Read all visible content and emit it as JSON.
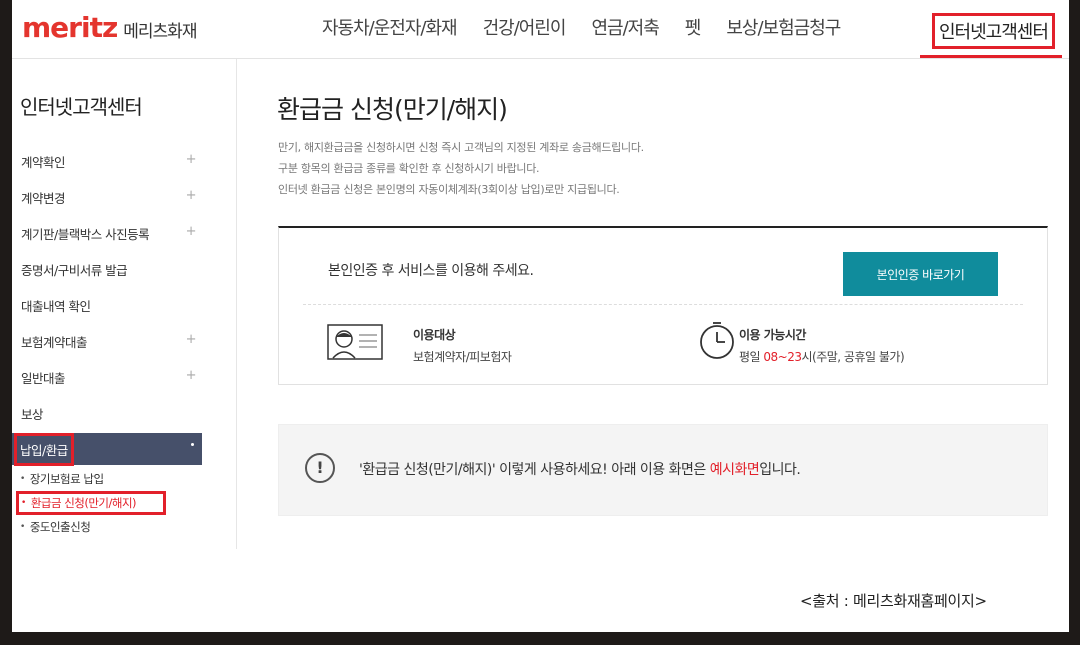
{
  "header": {
    "logo_brand": "meritz",
    "logo_sub": "메리츠화재",
    "nav": [
      "자동차/운전자/화재",
      "건강/어린이",
      "연금/저축",
      "펫",
      "보상/보험금청구"
    ],
    "nav_active": "인터넷고객센터"
  },
  "sidebar": {
    "title": "인터넷고객센터",
    "items": [
      {
        "label": "계약확인",
        "plus": "+"
      },
      {
        "label": "계약변경",
        "plus": "+"
      },
      {
        "label": "계기판/블랙박스 사진등록",
        "plus": "+"
      },
      {
        "label": "증명서/구비서류 발급",
        "plus": ""
      },
      {
        "label": "대출내역 확인",
        "plus": ""
      },
      {
        "label": "보험계약대출",
        "plus": "+"
      },
      {
        "label": "일반대출",
        "plus": "+"
      },
      {
        "label": "보상",
        "plus": ""
      }
    ],
    "active_item": "납입/환급",
    "sub_items": [
      "장기보험료 납입",
      "환급금 신청(만기/해지)",
      "중도인출신청"
    ]
  },
  "main": {
    "title": "환급금 신청(만기/해지)",
    "desc": [
      "만기, 해지환급금을 신청하시면 신청 즉시 고객님의 지정된 계좌로 송금해드립니다.",
      "구분 항목의 환급금 종류를 확인한 후 신청하시기 바랍니다.",
      "인터넷 환급금 신청은 본인명의 자동이체계좌(3회이상 납입)로만 지급됩니다."
    ],
    "auth_msg": "본인인증 후 서비스를 이용해 주세요.",
    "auth_button": "본인인증 바로가기",
    "target_label": "이용대상",
    "target_value": "보험계약자/피보험자",
    "time_label": "이용 가능시간",
    "time_prefix": "평일 ",
    "time_hours": "08~23",
    "time_suffix": "시(주말, 공휴일 불가)",
    "notice_prefix": "'환급금 신청(만기/해지)' 이렇게 사용하세요! 아래 이용 화면은 ",
    "notice_link": "예시화면",
    "notice_suffix": "입니다."
  },
  "source": "<출처 : 메리츠화재홈페이지>",
  "colors": {
    "brand": "#e4352e",
    "accent": "#108c9c",
    "highlight": "#e2202a",
    "sidebar_active": "#46506a"
  }
}
